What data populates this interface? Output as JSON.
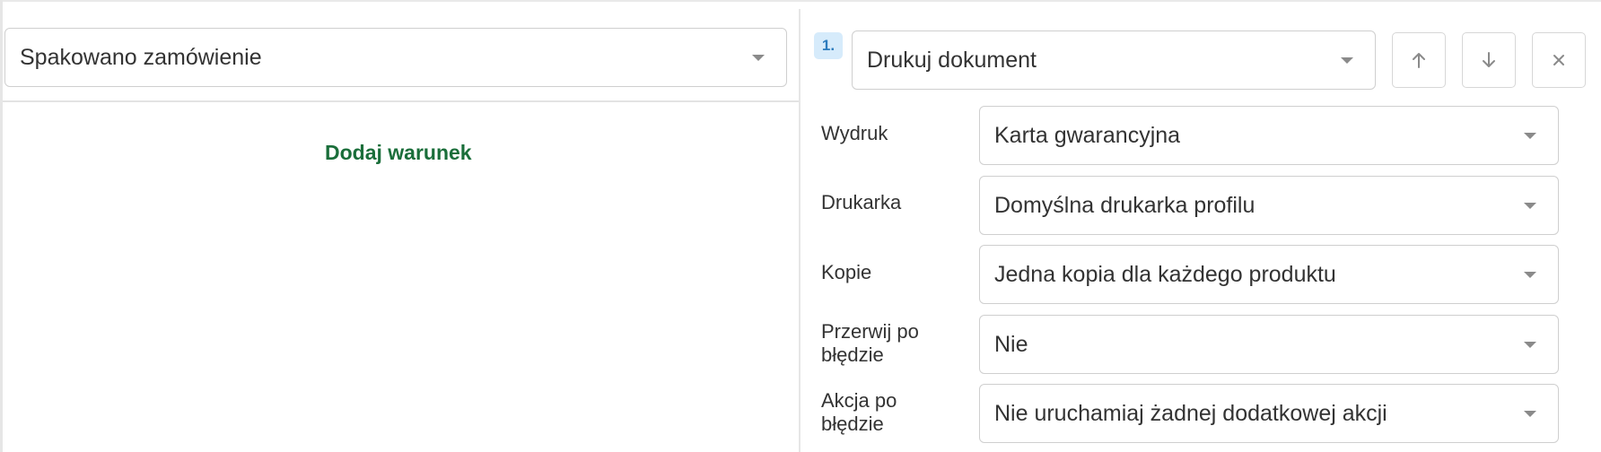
{
  "trigger": {
    "event_value": "Spakowano zamówienie",
    "add_condition_label": "Dodaj warunek"
  },
  "action": {
    "step_number": "1.",
    "type_value": "Drukuj dokument",
    "move_up_icon": "arrow-up-icon",
    "move_down_icon": "arrow-down-icon",
    "remove_icon": "close-icon"
  },
  "fields": {
    "wydruk": {
      "label": "Wydruk",
      "value": "Karta gwarancyjna"
    },
    "drukarka": {
      "label": "Drukarka",
      "value": "Domyślna drukarka profilu"
    },
    "kopie": {
      "label": "Kopie",
      "value": "Jedna kopia dla każdego produktu"
    },
    "przerwij": {
      "label_line1": "Przerwij po",
      "label_line2": "błędzie",
      "value": "Nie"
    },
    "akcja": {
      "label_line1": "Akcja po",
      "label_line2": "błędzie",
      "value": "Nie uruchamiaj żadnej dodatkowej akcji"
    }
  },
  "colors": {
    "accent_green": "#1a6e3a",
    "badge_bg": "#d6ebfb",
    "badge_text": "#2b7bbd",
    "border": "#cfcfcf"
  }
}
